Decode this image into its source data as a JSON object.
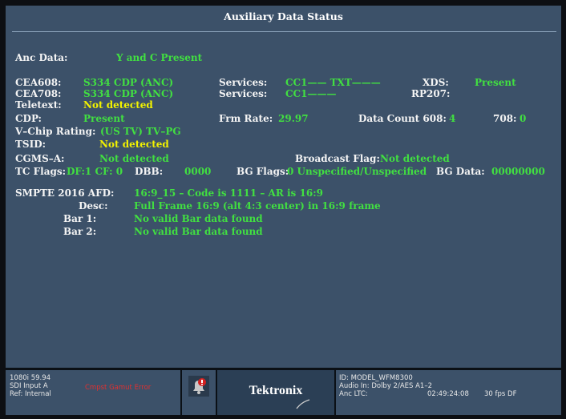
{
  "title": "Auxiliary Data Status",
  "anc": {
    "label": "Anc Data:",
    "value": "Y and C Present"
  },
  "cea608": {
    "label": "CEA608:",
    "value": "S334 CDP (ANC)",
    "services_label": "Services:",
    "services_value": "CC1—— TXT———",
    "xds_label": "XDS:",
    "xds_value": "Present"
  },
  "cea708": {
    "label": "CEA708:",
    "value": "S334 CDP (ANC)",
    "services_label": "Services:",
    "services_value": "CC1———",
    "rp207_label": "RP207:"
  },
  "teletext": {
    "label": "Teletext:",
    "value": "Not detected"
  },
  "cdp": {
    "label": "CDP:",
    "value": "Present",
    "frm_label": "Frm Rate:",
    "frm_value": "29.97",
    "dc608_label": "Data Count 608:",
    "dc608_value": "4",
    "dc708_label": "708:",
    "dc708_value": "0"
  },
  "vchip": {
    "label": "V–Chip Rating:",
    "value": "(US TV) TV–PG"
  },
  "tsid": {
    "label": "TSID:",
    "value": "Not detected"
  },
  "cgms": {
    "label": "CGMS–A:",
    "value": "Not detected",
    "bf_label": "Broadcast Flag:",
    "bf_value": "Not detected"
  },
  "tc": {
    "label": "TC Flags:",
    "value": "DF:1 CF: 0",
    "dbb_label": "DBB:",
    "dbb_value": "0000",
    "bgflags_label": "BG Flags:",
    "bgflags_value": "0 Unspecified/Unspecified",
    "bgdata_label": "BG Data:",
    "bgdata_value": "00000000"
  },
  "afd": {
    "label": "SMPTE 2016 AFD:",
    "value": "16:9_15 – Code is 1111 – AR is 16:9",
    "desc_label": "Desc:",
    "desc_value": "Full Frame 16:9 (alt 4:3 center) in 16:9 frame",
    "bar1_label": "Bar 1:",
    "bar1_value": "No valid Bar data found",
    "bar2_label": "Bar 2:",
    "bar2_value": "No valid Bar data found"
  },
  "status_bar": {
    "format": "1080i 59.94",
    "input": "SDI Input A",
    "ref": "Ref: Internal",
    "error": "Cmpst Gamut Error",
    "alarm_icon": "alarm-bell-icon",
    "brand": "Tektronix",
    "id": "ID: MODEL_WFM8300",
    "audio": "Audio In: Dolby 2/AES A1–2",
    "ltc_label": "Anc LTC:",
    "ltc_time": "02:49:24:08",
    "ltc_rate": "30 fps DF"
  },
  "colors": {
    "background": "#3c5169",
    "label": "#f4f4f4",
    "value_ok": "#41df41",
    "value_warn": "#f2f200",
    "error": "#e03030"
  }
}
